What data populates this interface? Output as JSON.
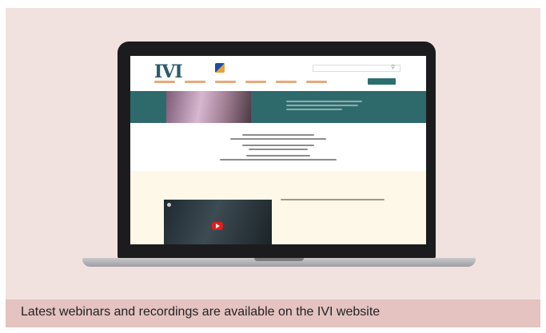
{
  "caption": "Latest webinars and recordings are available on the IVI website",
  "site": {
    "logo_text": "IVI",
    "colors": {
      "brand_teal": "#2e6a6c",
      "accent_turquoise": "#2a9b9a",
      "nav_orange": "#e8a978",
      "page_cream": "#fdf8e8",
      "card_pink": "#f1e2df",
      "caption_pink": "#e4c3c0",
      "play_red": "#e01e1e"
    },
    "icons": [
      "search-icon",
      "play-icon"
    ]
  }
}
